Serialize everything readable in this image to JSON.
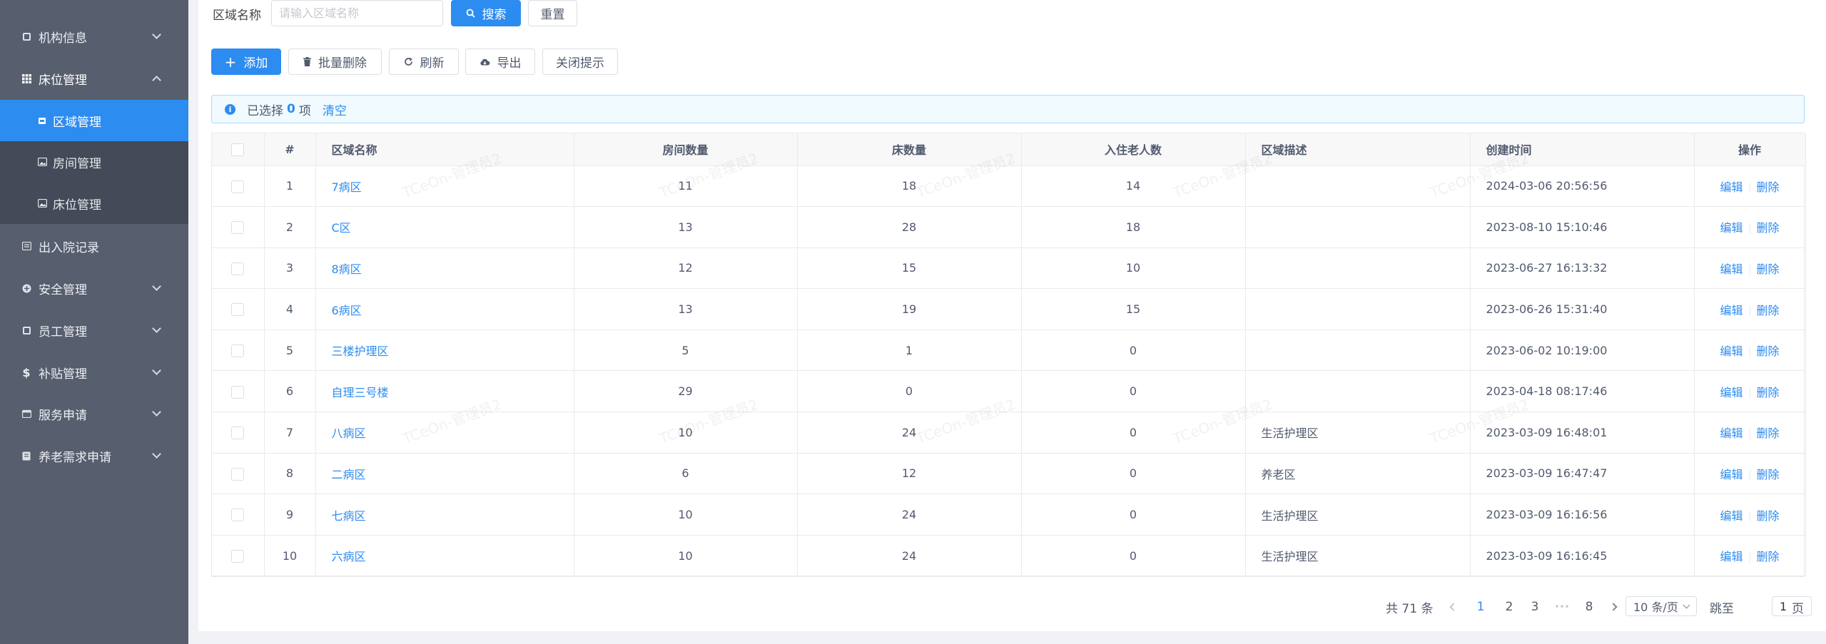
{
  "sidebar": {
    "items": [
      {
        "label": "机构信息",
        "icon": "building-icon"
      },
      {
        "label": "床位管理",
        "icon": "grid-icon"
      },
      {
        "label": "出入院记录",
        "icon": "record-icon"
      },
      {
        "label": "安全管理",
        "icon": "shield-icon"
      },
      {
        "label": "员工管理",
        "icon": "staff-icon"
      },
      {
        "label": "补贴管理",
        "icon": "dollar-icon"
      },
      {
        "label": "服务申请",
        "icon": "calendar-icon"
      },
      {
        "label": "养老需求申请",
        "icon": "document-icon"
      }
    ],
    "submenu": [
      {
        "label": "区域管理",
        "icon": "area-icon"
      },
      {
        "label": "房间管理",
        "icon": "image-icon"
      },
      {
        "label": "床位管理",
        "icon": "image-icon"
      }
    ]
  },
  "search": {
    "label": "区域名称",
    "placeholder": "请输入区域名称",
    "search_label": "搜索",
    "reset_label": "重置"
  },
  "toolbar": {
    "add": "添加",
    "batch_delete": "批量删除",
    "refresh": "刷新",
    "export": "导出",
    "close_tip": "关闭提示"
  },
  "alert": {
    "prefix": "已选择",
    "count": "0",
    "suffix": "项",
    "clear": "清空"
  },
  "table": {
    "columns": [
      "#",
      "区域名称",
      "房间数量",
      "床数量",
      "入住老人数",
      "区域描述",
      "创建时间",
      "操作"
    ],
    "rows": [
      {
        "no": "1",
        "name": "7病区",
        "rooms": "11",
        "beds": "18",
        "elders": "14",
        "desc": "",
        "created": "2024-03-06 20:56:56"
      },
      {
        "no": "2",
        "name": "C区",
        "rooms": "13",
        "beds": "28",
        "elders": "18",
        "desc": "",
        "created": "2023-08-10 15:10:46"
      },
      {
        "no": "3",
        "name": "8病区",
        "rooms": "12",
        "beds": "15",
        "elders": "10",
        "desc": "",
        "created": "2023-06-27 16:13:32"
      },
      {
        "no": "4",
        "name": "6病区",
        "rooms": "13",
        "beds": "19",
        "elders": "15",
        "desc": "",
        "created": "2023-06-26 15:31:40"
      },
      {
        "no": "5",
        "name": "三楼护理区",
        "rooms": "5",
        "beds": "1",
        "elders": "0",
        "desc": "",
        "created": "2023-06-02 10:19:00"
      },
      {
        "no": "6",
        "name": "自理三号楼",
        "rooms": "29",
        "beds": "0",
        "elders": "0",
        "desc": "",
        "created": "2023-04-18 08:17:46"
      },
      {
        "no": "7",
        "name": "八病区",
        "rooms": "10",
        "beds": "24",
        "elders": "0",
        "desc": "生活护理区",
        "created": "2023-03-09 16:48:01"
      },
      {
        "no": "8",
        "name": "二病区",
        "rooms": "6",
        "beds": "12",
        "elders": "0",
        "desc": "养老区",
        "created": "2023-03-09 16:47:47"
      },
      {
        "no": "9",
        "name": "七病区",
        "rooms": "10",
        "beds": "24",
        "elders": "0",
        "desc": "生活护理区",
        "created": "2023-03-09 16:16:56"
      },
      {
        "no": "10",
        "name": "六病区",
        "rooms": "10",
        "beds": "24",
        "elders": "0",
        "desc": "生活护理区",
        "created": "2023-03-09 16:16:45"
      }
    ],
    "edit_label": "编辑",
    "delete_label": "删除"
  },
  "pagination": {
    "total": "共 71 条",
    "pages": [
      "1",
      "2",
      "3",
      "8"
    ],
    "ellipsis": "•••",
    "current": "1",
    "page_size": "10 条/页",
    "jump_prefix": "跳至",
    "jump_value": "1",
    "jump_suffix": "页"
  },
  "watermark": "TCeOn-管理员2",
  "colors": {
    "sidebar_bg": "#575e6e",
    "submenu_bg": "#444a57",
    "primary": "#2d8cf0"
  }
}
